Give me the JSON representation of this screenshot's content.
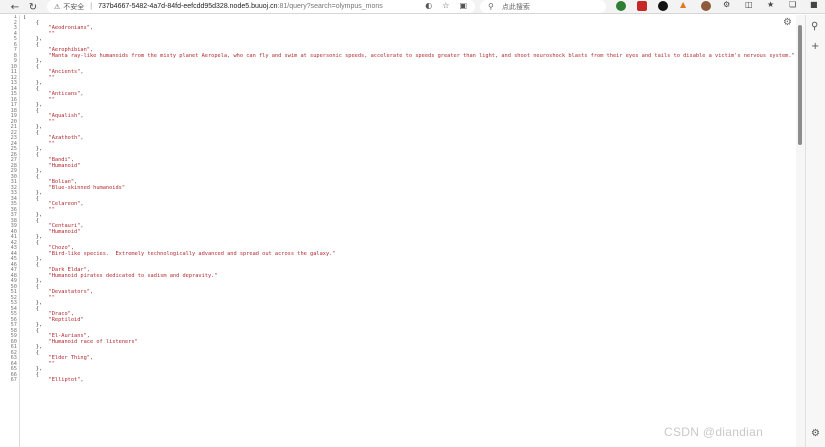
{
  "browser": {
    "insecure_label": "不安全",
    "url_host": "737b4667-5482-4a7d-84fd-eefcdd95d328.node5.buuoj.cn",
    "url_rest": ":81/query?search=olympus_mons",
    "search_placeholder": "点此搜索"
  },
  "colors": {
    "accent": "#b0282c"
  },
  "json_lines": [
    "[",
    "    {",
    "        \"Aeodronians\",",
    "        \"\"",
    "    },",
    "    {",
    "        \"Aerophibian\",",
    "        \"Manta ray-like humanoids from the misty planet Aeropela, who can fly and swim at supersonic speeds, accelerate to speeds greater than light, and shoot neuroshock blasts from their eyes and tails to disable a victim's nervous system.\"",
    "    },",
    "    {",
    "        \"Ancients\",",
    "        \"\"",
    "    },",
    "    {",
    "        \"Anticans\",",
    "        \"\"",
    "    },",
    "    {",
    "        \"Aqualish\",",
    "        \"\"",
    "    },",
    "    {",
    "        \"Azathoth\",",
    "        \"\"",
    "    },",
    "    {",
    "        \"Bandi\",",
    "        \"Humanoid\"",
    "    },",
    "    {",
    "        \"Bolian\",",
    "        \"Blue-skinned humanoids\"",
    "    },",
    "    {",
    "        \"Celareon\",",
    "        \"\"",
    "    },",
    "    {",
    "        \"Centauri\",",
    "        \"Humanoid\"",
    "    },",
    "    {",
    "        \"Chozo\",",
    "        \"Bird-like species.  Extremely technologically advanced and spread out across the galaxy.\"",
    "    },",
    "    {",
    "        \"Dark Eldar\",",
    "        \"Humanoid pirates dedicated to sadism and depravity.\"",
    "    },",
    "    {",
    "        \"Devastators\",",
    "        \"\"",
    "    },",
    "    {",
    "        \"Draco\",",
    "        \"Reptiloid\"",
    "    },",
    "    {",
    "        \"El-Aurians\",",
    "        \"Humanoid race of listeners\"",
    "    },",
    "    {",
    "        \"Elder Thing\",",
    "        \"\"",
    "    },",
    "    {",
    "        \"Elliptot\","
  ],
  "watermark": "CSDN @diandian"
}
